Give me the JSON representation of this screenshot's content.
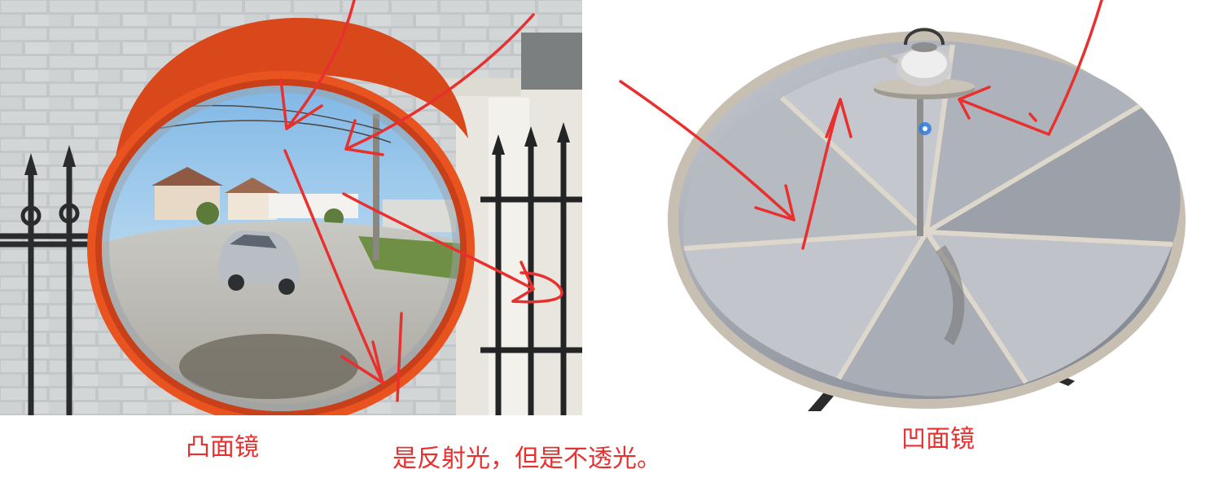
{
  "captions": {
    "convex_mirror": "凸面镜",
    "note": "是反射光，但是不透光。",
    "concave_mirror": "凹面镜"
  },
  "colors": {
    "annotation_red": "#e8302e",
    "mirror_frame_orange": "#e8531f",
    "sky_blue": "#8fc3ea",
    "wall_gray": "#c9ccce",
    "cursor_blue": "#2f7fe0"
  }
}
